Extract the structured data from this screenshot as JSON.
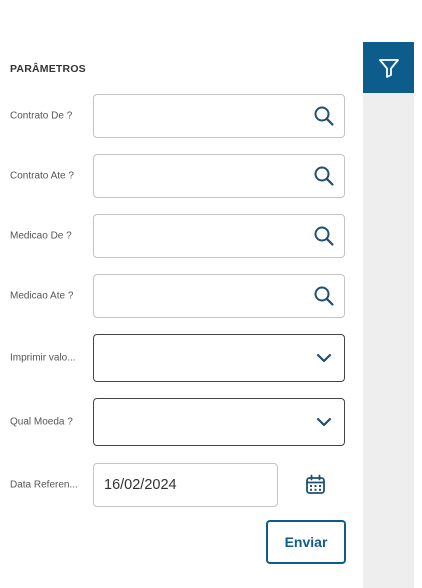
{
  "sidebar": {
    "filter_icon": "filter-icon"
  },
  "form": {
    "section_title": "PARÂMETROS",
    "fields": [
      {
        "label": "Contrato De ?",
        "value": "",
        "icon": "search-icon"
      },
      {
        "label": "Contrato Ate ?",
        "value": "",
        "icon": "search-icon"
      },
      {
        "label": "Medicao De ?",
        "value": "",
        "icon": "search-icon"
      },
      {
        "label": "Medicao Ate ?",
        "value": "",
        "icon": "search-icon"
      },
      {
        "label": "Imprimir valo...",
        "value": "",
        "icon": "chevron-down-icon"
      },
      {
        "label": "Qual Moeda ?",
        "value": "",
        "icon": "chevron-down-icon"
      },
      {
        "label": "Data Referen...",
        "value": "16/02/2024",
        "icon": "calendar-icon"
      }
    ],
    "submit_label": "Enviar"
  },
  "colors": {
    "accent": "#0c5c8c",
    "panel_bg": "#eeeeee",
    "input_border": "#c4c4c4"
  }
}
